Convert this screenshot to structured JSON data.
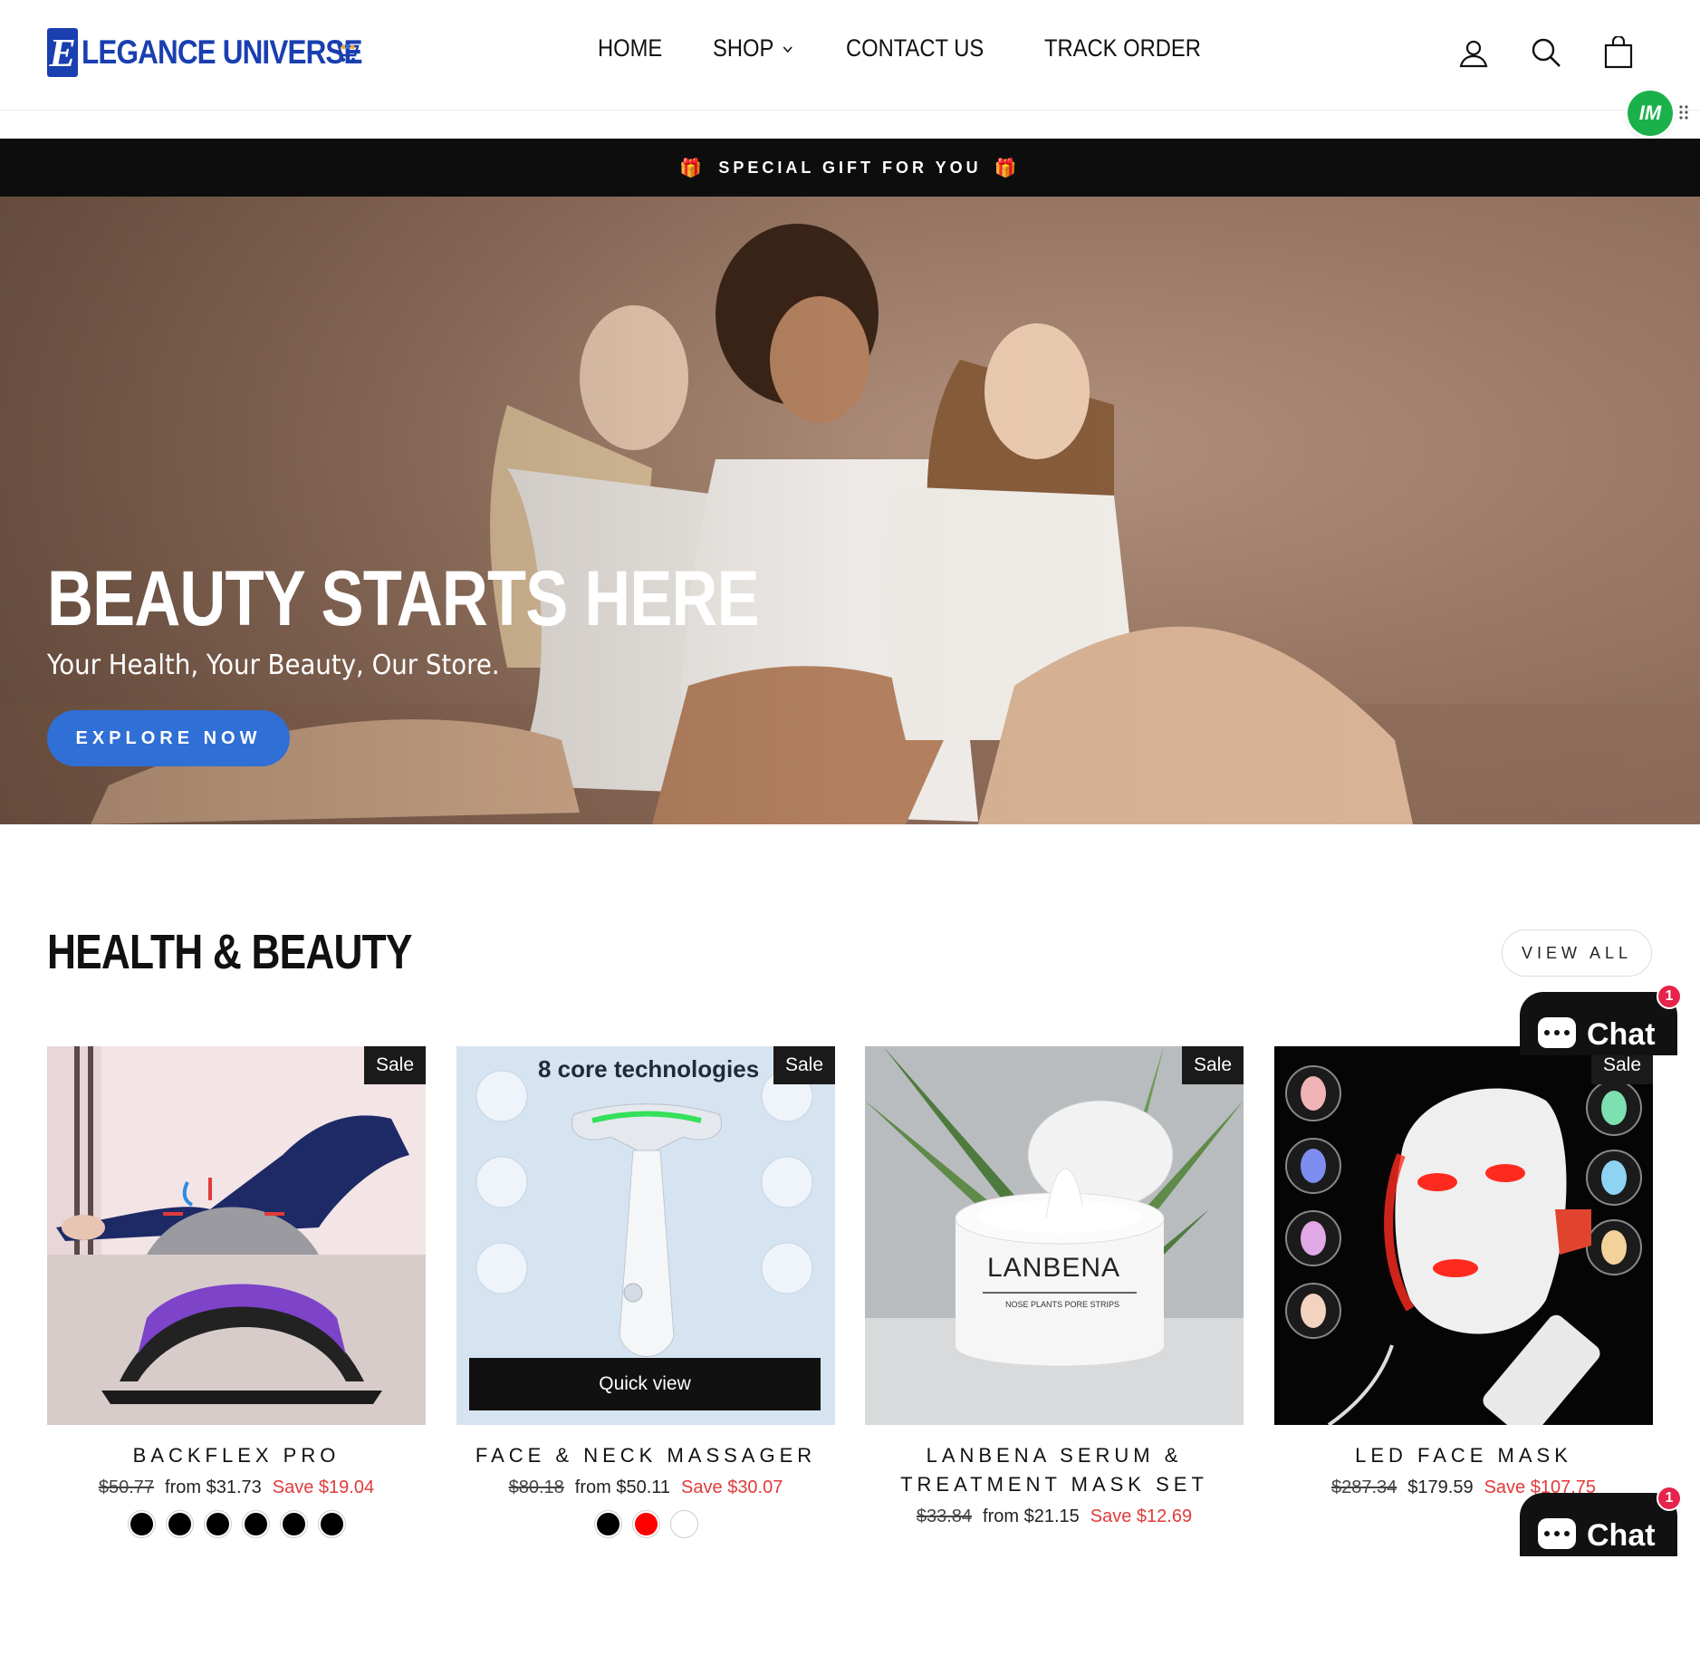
{
  "brand": {
    "logo_letter": "E",
    "logo_text": "LEGANCE UNIVERSE"
  },
  "nav": {
    "items": [
      {
        "label": "HOME"
      },
      {
        "label": "SHOP"
      },
      {
        "label": "CONTACT US"
      },
      {
        "label": "TRACK ORDER"
      }
    ]
  },
  "header_icons": [
    "account-icon",
    "search-icon",
    "cart-icon"
  ],
  "floating_badge": {
    "label": "IM"
  },
  "announcement": {
    "text": "SPECIAL GIFT FOR YOU",
    "gift_icon": "🎁"
  },
  "hero": {
    "title": "BEAUTY STARTS HERE",
    "subtitle": "Your Health, Your Beauty, Our Store.",
    "button": "EXPLORE NOW"
  },
  "section": {
    "title": "HEALTH & BEAUTY",
    "view_all": "VIEW ALL"
  },
  "products": [
    {
      "name": "BACKFLEX PRO",
      "badge": "Sale",
      "old_price": "$50.77",
      "price": "from $31.73",
      "save": "Save $19.04",
      "swatches": [
        "#000000",
        "#000000",
        "#000000",
        "#000000",
        "#000000",
        "#000000"
      ]
    },
    {
      "name": "FACE & NECK MASSAGER",
      "badge": "Sale",
      "old_price": "$80.18",
      "price": "from $50.11",
      "save": "Save $30.07",
      "quick_view": "Quick view",
      "image_heading": "8 core technologies",
      "swatches": [
        "#000000",
        "#ff0000",
        "#ffffff"
      ]
    },
    {
      "name": "LANBENA SERUM & TREATMENT MASK SET",
      "badge": "Sale",
      "old_price": "$33.84",
      "price": "from $21.15",
      "save": "Save $12.69",
      "image_label": "LANBENA",
      "image_sub": "NOSE PLANTS PORE STRIPS",
      "swatches": []
    },
    {
      "name": "LED FACE MASK",
      "badge": "Sale",
      "old_price": "$287.34",
      "price": "$179.59",
      "save": "Save $107.75",
      "swatches": []
    }
  ],
  "chat": {
    "label": "Chat",
    "count": "1"
  },
  "colors": {
    "accent_blue": "#2f6fd6",
    "brand_blue": "#1a3fb0",
    "sale_red": "#e23a3a",
    "announcement_bg": "#0d0d0d",
    "chat_badge": "#e6234b"
  }
}
